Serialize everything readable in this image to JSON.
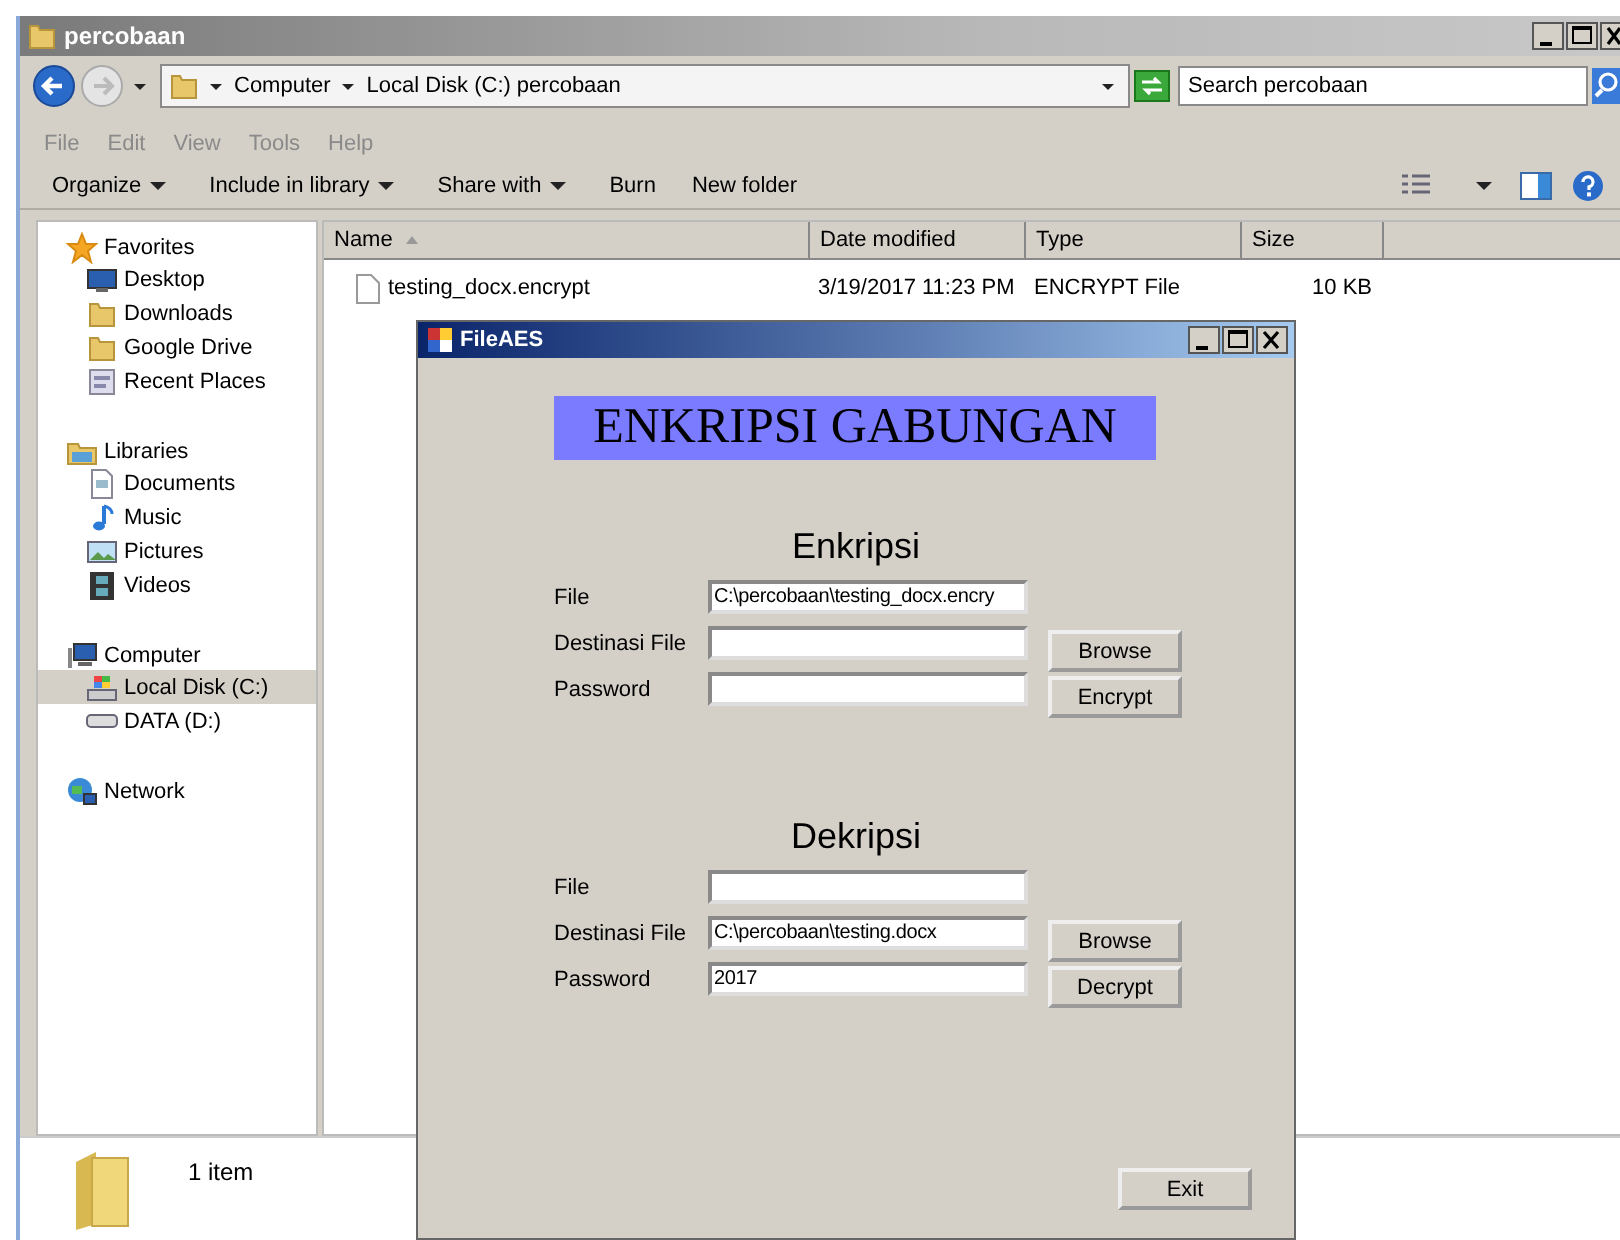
{
  "window": {
    "title": "percobaan"
  },
  "address": {
    "crumbs": [
      "Computer",
      "Local Disk (C:)",
      "percobaan"
    ],
    "search": {
      "placeholder": "Search percobaan"
    }
  },
  "menu": [
    {
      "label": "File",
      "disabled": true
    },
    {
      "label": "Edit",
      "disabled": true
    },
    {
      "label": "View",
      "disabled": true
    },
    {
      "label": "Tools",
      "disabled": true
    },
    {
      "label": "Help",
      "disabled": true
    }
  ],
  "toolbar": [
    {
      "label": "Organize",
      "dropdown": true
    },
    {
      "label": "Include in library",
      "dropdown": true
    },
    {
      "label": "Share with",
      "dropdown": true
    },
    {
      "label": "Burn",
      "dropdown": false
    },
    {
      "label": "New folder",
      "dropdown": false
    }
  ],
  "sidebar": {
    "groups": [
      {
        "label": "Favorites",
        "kind": "star",
        "items": [
          {
            "label": "Desktop",
            "kind": "desktop",
            "selected": false
          },
          {
            "label": "Downloads",
            "kind": "folder",
            "selected": false
          },
          {
            "label": "Google Drive",
            "kind": "folder",
            "selected": false
          },
          {
            "label": "Recent Places",
            "kind": "recent",
            "selected": false
          }
        ]
      },
      {
        "label": "Libraries",
        "kind": "library",
        "items": [
          {
            "label": "Documents",
            "kind": "document",
            "selected": false
          },
          {
            "label": "Music",
            "kind": "music",
            "selected": false
          },
          {
            "label": "Pictures",
            "kind": "picture",
            "selected": false
          },
          {
            "label": "Videos",
            "kind": "video",
            "selected": false
          }
        ]
      },
      {
        "label": "Computer",
        "kind": "computer",
        "items": [
          {
            "label": "Local Disk (C:)",
            "kind": "disk",
            "selected": true
          },
          {
            "label": "DATA (D:)",
            "kind": "drive",
            "selected": false
          }
        ]
      },
      {
        "label": "Network",
        "kind": "network"
      }
    ]
  },
  "table": {
    "columns": [
      {
        "label": "Name",
        "sorted": true
      },
      {
        "label": "Date modified",
        "sorted": false
      },
      {
        "label": "Type",
        "sorted": false
      },
      {
        "label": "Size",
        "sorted": false
      }
    ],
    "rows": [
      {
        "name": "testing_docx.encrypt",
        "date": "3/19/2017 11:23 PM",
        "type": "ENCRYPT File",
        "size": "10 KB"
      }
    ]
  },
  "status_bar": {
    "text": "1 item"
  },
  "dialog": {
    "title": "FileAES",
    "banner": "ENKRIPSI GABUNGAN",
    "sections": [
      {
        "title": "Enkripsi",
        "fields": [
          {
            "label": "File",
            "value": "C:\\percobaan\\testing_docx.encry"
          },
          {
            "label": "Destinasi File"
          },
          {
            "label": "Password"
          }
        ],
        "buttons": [
          "Browse",
          "Encrypt"
        ]
      },
      {
        "title": "Dekripsi",
        "fields": [
          {
            "label": "File"
          },
          {
            "label": "Destinasi File",
            "value": "C:\\percobaan\\testing.docx"
          },
          {
            "label": "Password",
            "value": "2017"
          }
        ],
        "buttons": [
          "Browse",
          "Decrypt"
        ]
      }
    ],
    "exit": "Exit"
  }
}
